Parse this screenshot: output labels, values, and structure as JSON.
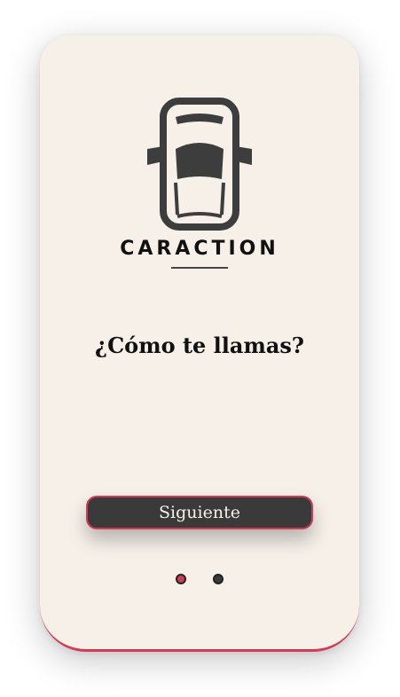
{
  "brand": {
    "name": "CARACTION",
    "icon": "car-top-view-icon"
  },
  "onboarding": {
    "question": "¿Cómo te llamas?",
    "next_label": "Siguiente",
    "pager": {
      "total": 2,
      "current": 1
    }
  },
  "colors": {
    "background": "#f6f0e9",
    "accent": "#d23a57",
    "button": "#3a3a3a",
    "text": "#111111"
  }
}
